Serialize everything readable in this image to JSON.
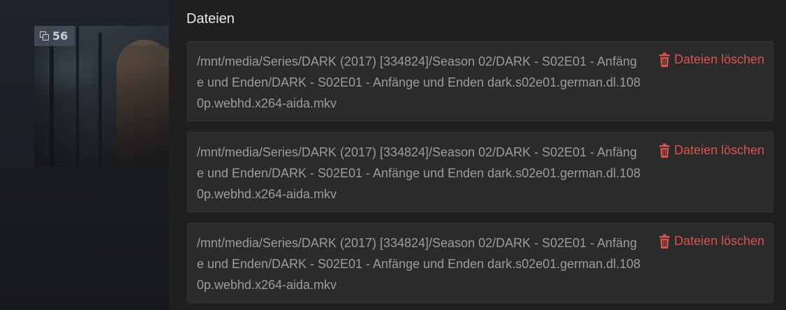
{
  "thumbnail": {
    "badge_count": "56",
    "badge_icon": "copy-icon"
  },
  "panel": {
    "title": "Dateien",
    "files": [
      {
        "path": "/mnt/media/Series/DARK (2017) [334824]/Season 02/DARK - S02E01 - Anfänge und Enden/DARK - S02E01 - Anfänge und Enden dark.s02e01.german.dl.1080p.webhd.x264-aida.mkv",
        "delete_label": "Dateien löschen",
        "delete_icon": "trash-icon"
      },
      {
        "path": "/mnt/media/Series/DARK (2017) [334824]/Season 02/DARK - S02E01 - Anfänge und Enden/DARK - S02E01 - Anfänge und Enden dark.s02e01.german.dl.1080p.webhd.x264-aida.mkv",
        "delete_label": "Dateien löschen",
        "delete_icon": "trash-icon"
      },
      {
        "path": "/mnt/media/Series/DARK (2017) [334824]/Season 02/DARK - S02E01 - Anfänge und Enden/DARK - S02E01 - Anfänge und Enden dark.s02e01.german.dl.1080p.webhd.x264-aida.mkv",
        "delete_label": "Dateien löschen",
        "delete_icon": "trash-icon"
      }
    ]
  },
  "colors": {
    "panel_bg": "#1f1f1f",
    "card_bg": "#2b2b2b",
    "danger": "#d9534f",
    "text_muted": "#9c9c9c",
    "title_text": "#e8e8e8"
  }
}
